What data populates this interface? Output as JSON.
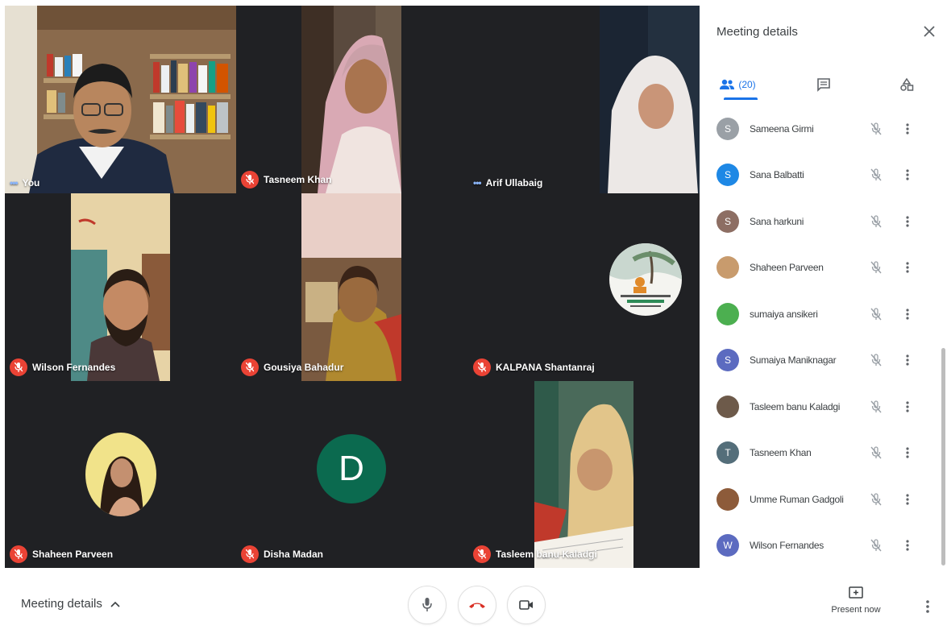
{
  "tiles": [
    {
      "name": "You",
      "status": "talking"
    },
    {
      "name": "Tasneem Khan",
      "status": "muted"
    },
    {
      "name": "Arif Ullabaig",
      "status": "talking"
    },
    {
      "name": "Wilson Fernandes",
      "status": "muted"
    },
    {
      "name": "Gousiya Bahadur",
      "status": "muted"
    },
    {
      "name": "KALPANA Shantanraj",
      "status": "muted"
    },
    {
      "name": "Shaheen Parveen",
      "status": "muted"
    },
    {
      "name": "Disha Madan",
      "status": "muted",
      "avatar_letter": "D"
    },
    {
      "name": "Tasleem banu Kaladgi",
      "status": "muted"
    }
  ],
  "panel": {
    "title": "Meeting details",
    "people_count": "(20)",
    "people": [
      {
        "name": "Sameena Girmi",
        "avatar_letter": "S",
        "avatar_color": "#9aa0a6"
      },
      {
        "name": "Sana Balbatti",
        "avatar_letter": "S",
        "avatar_color": "#1e88e5"
      },
      {
        "name": "Sana harkuni",
        "avatar_letter": "S",
        "avatar_color": "#8d6e63"
      },
      {
        "name": "Shaheen Parveen",
        "avatar_letter": "",
        "avatar_color": "#c89b6d"
      },
      {
        "name": "sumaiya ansikeri",
        "avatar_letter": "",
        "avatar_color": "#4caf50"
      },
      {
        "name": "Sumaiya Maniknagar",
        "avatar_letter": "S",
        "avatar_color": "#5c6bc0"
      },
      {
        "name": "Tasleem banu Kaladgi",
        "avatar_letter": "",
        "avatar_color": "#6d5a4a"
      },
      {
        "name": "Tasneem Khan",
        "avatar_letter": "T",
        "avatar_color": "#546e7a"
      },
      {
        "name": "Umme Ruman Gadgoli",
        "avatar_letter": "",
        "avatar_color": "#8d5b3a"
      },
      {
        "name": "Wilson Fernandes",
        "avatar_letter": "W",
        "avatar_color": "#5c6bc0"
      }
    ]
  },
  "bottombar": {
    "meeting_details_label": "Meeting details",
    "present_label": "Present now"
  },
  "colors": {
    "accent": "#1a73e8",
    "muted_badge": "#ea4335",
    "tile_bg": "#202124",
    "disha_avatar": "#0b6a4f"
  }
}
